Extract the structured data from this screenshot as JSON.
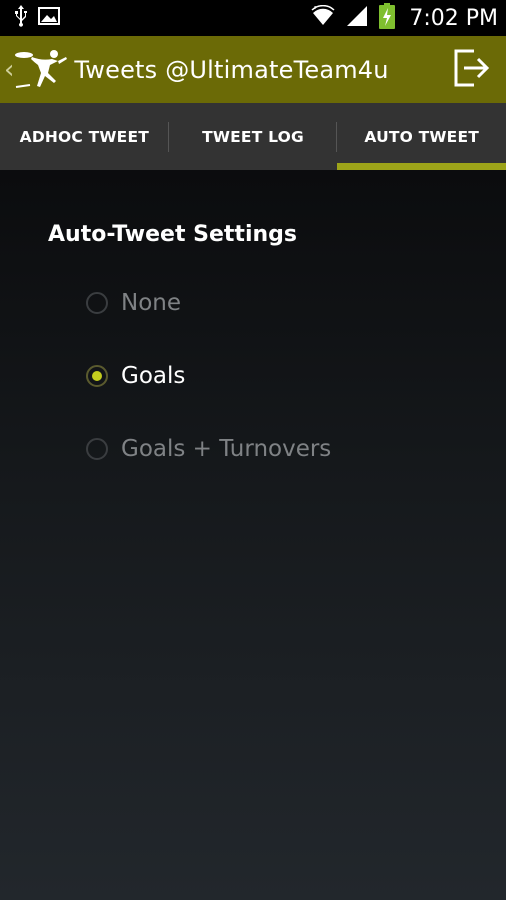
{
  "status_bar": {
    "time": "7:02 PM",
    "icons": [
      "usb-icon",
      "image-icon",
      "wifi-icon",
      "signal-icon",
      "battery-charging-icon"
    ]
  },
  "action_bar": {
    "title": "Tweets @UltimateTeam4u",
    "logo": "ultimate-frisbee-logo",
    "exit_icon": "logout-icon"
  },
  "tabs": [
    {
      "label": "ADHOC TWEET",
      "selected": false
    },
    {
      "label": "TWEET LOG",
      "selected": false
    },
    {
      "label": "AUTO TWEET",
      "selected": true
    }
  ],
  "settings": {
    "title": "Auto-Tweet Settings",
    "options": [
      {
        "label": "None",
        "checked": false
      },
      {
        "label": "Goals",
        "checked": true
      },
      {
        "label": "Goals + Turnovers",
        "checked": false
      }
    ]
  },
  "colors": {
    "action_bar": "#6b6a06",
    "tab_indicator": "#9da419",
    "radio_checked": "#c3cc1e"
  }
}
